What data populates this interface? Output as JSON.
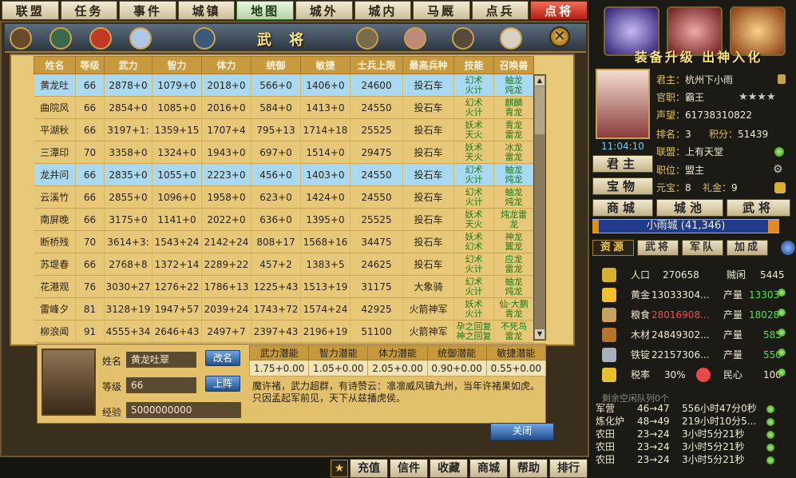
{
  "topnav": [
    "联盟",
    "任务",
    "事件",
    "城镇",
    "地图",
    "城外",
    "城内",
    "马厩",
    "点兵",
    "点将"
  ],
  "panel": {
    "title": "武 将",
    "close_label": "关闭"
  },
  "table": {
    "headers": [
      "姓名",
      "等级",
      "武力",
      "智力",
      "体力",
      "统御",
      "敏捷",
      "士兵上限",
      "最高兵种",
      "技能",
      "召唤兽"
    ],
    "rows": [
      {
        "name": "黄龙吐",
        "lv": "66",
        "wu": "2878+0",
        "zhi": "1079+0",
        "ti": "2018+0",
        "tong": "566+0",
        "min": "1406+0",
        "cap": "24600",
        "troop": "投石车",
        "skill": [
          "幻术",
          "火计"
        ],
        "beast": [
          "蚰龙",
          "炖龙"
        ],
        "selected": true
      },
      {
        "name": "曲院风",
        "lv": "66",
        "wu": "2854+0",
        "zhi": "1085+0",
        "ti": "2016+0",
        "tong": "584+0",
        "min": "1413+0",
        "cap": "24550",
        "troop": "投石车",
        "skill": [
          "幻术",
          "火计"
        ],
        "beast": [
          "麒麟",
          "青龙"
        ],
        "selected": false
      },
      {
        "name": "平湖秋",
        "lv": "66",
        "wu": "3197+1:",
        "zhi": "1359+15",
        "ti": "1707+4",
        "tong": "795+13",
        "min": "1714+18",
        "cap": "25525",
        "troop": "投石车",
        "skill": [
          "妖术",
          "天火"
        ],
        "beast": [
          "青龙",
          "雷龙"
        ],
        "selected": false
      },
      {
        "name": "三潭印",
        "lv": "70",
        "wu": "3358+0",
        "zhi": "1324+0",
        "ti": "1943+0",
        "tong": "697+0",
        "min": "1514+0",
        "cap": "29475",
        "troop": "投石车",
        "skill": [
          "妖术",
          "天火"
        ],
        "beast": [
          "冰龙",
          "雷龙"
        ],
        "selected": false
      },
      {
        "name": "龙井问",
        "lv": "66",
        "wu": "2835+0",
        "zhi": "1055+0",
        "ti": "2223+0",
        "tong": "456+0",
        "min": "1403+0",
        "cap": "24550",
        "troop": "投石车",
        "skill": [
          "幻术",
          "火计"
        ],
        "beast": [
          "蚰龙",
          "炖龙"
        ],
        "selected": true
      },
      {
        "name": "云溪竹",
        "lv": "66",
        "wu": "2855+0",
        "zhi": "1096+0",
        "ti": "1958+0",
        "tong": "623+0",
        "min": "1424+0",
        "cap": "24550",
        "troop": "投石车",
        "skill": [
          "幻术",
          "火计"
        ],
        "beast": [
          "蚰龙",
          "炖龙"
        ],
        "selected": false
      },
      {
        "name": "南屏晚",
        "lv": "66",
        "wu": "3175+0",
        "zhi": "1141+0",
        "ti": "2022+0",
        "tong": "636+0",
        "min": "1395+0",
        "cap": "25525",
        "troop": "投石车",
        "skill": [
          "妖术",
          "天火"
        ],
        "beast": [
          "炖龙雷",
          "龙"
        ],
        "selected": false
      },
      {
        "name": "断桥残",
        "lv": "70",
        "wu": "3614+3:",
        "zhi": "1543+24",
        "ti": "2142+24",
        "tong": "808+17",
        "min": "1568+16",
        "cap": "34475",
        "troop": "投石车",
        "skill": [
          "妖术",
          "幻术"
        ],
        "beast": [
          "神龙",
          "翼龙"
        ],
        "selected": false
      },
      {
        "name": "苏堤春",
        "lv": "66",
        "wu": "2768+8",
        "zhi": "1372+14",
        "ti": "2289+22",
        "tong": "457+2",
        "min": "1383+5",
        "cap": "24625",
        "troop": "投石车",
        "skill": [
          "幻术",
          "火计"
        ],
        "beast": [
          "应龙",
          "雷龙"
        ],
        "selected": false
      },
      {
        "name": "花港观",
        "lv": "76",
        "wu": "3030+27",
        "zhi": "1276+22",
        "ti": "1786+13",
        "tong": "1225+43",
        "min": "1513+19",
        "cap": "31175",
        "troop": "大象骑",
        "skill": [
          "幻术",
          "火计"
        ],
        "beast": [
          "蚰龙",
          "炖龙"
        ],
        "selected": false
      },
      {
        "name": "雷峰夕",
        "lv": "81",
        "wu": "3128+19",
        "zhi": "1947+57",
        "ti": "2039+24",
        "tong": "1743+72",
        "min": "1574+24",
        "cap": "42925",
        "troop": "火箭神军",
        "skill": [
          "妖术",
          "火计"
        ],
        "beast": [
          "仙·大鹏",
          "青龙"
        ],
        "selected": false
      },
      {
        "name": "柳浪闻",
        "lv": "91",
        "wu": "4555+34",
        "zhi": "2646+43",
        "ti": "2497+7",
        "tong": "2397+43",
        "min": "2196+19",
        "cap": "51100",
        "troop": "火箭神军",
        "skill": [
          "孕之回复",
          "神之回复"
        ],
        "beast": [
          "不死鸟",
          "雷龙"
        ],
        "selected": false
      }
    ]
  },
  "detail": {
    "name_label": "姓名",
    "name_value": "黄龙吐翠",
    "level_label": "等级",
    "level_value": "66",
    "exp_label": "经验",
    "exp_value": "5000000000",
    "rename_btn": "改名",
    "deploy_btn": "上阵",
    "potential_headers": [
      "武力潜能",
      "智力潜能",
      "体力潜能",
      "统御潜能",
      "敏捷潜能"
    ],
    "potential_values": [
      "1.75+0.00",
      "1.05+0.00",
      "2.05+0.00",
      "0.90+0.00",
      "0.55+0.00"
    ],
    "description": "魔许褚，武力超群，有诗赞云：凛凛威风镇九州，当年许褚果如虎。只因孟起军前见，天下从兹播虎侯。"
  },
  "bottomnav": [
    "充值",
    "信件",
    "收藏",
    "商城",
    "帮助",
    "排行"
  ],
  "right": {
    "equip_banner": "装备升级 出神入化",
    "clock": "11:04:10",
    "info": [
      {
        "label": "君主：",
        "value": "杭州下小雨"
      },
      {
        "label": "官职：",
        "value": "霸王"
      },
      {
        "label": "声望：",
        "value": "61738310822"
      },
      {
        "label": "排名：",
        "value": "3"
      },
      {
        "label": "积分：",
        "value": "51439"
      },
      {
        "label": "联盟：",
        "value": "上有天堂"
      },
      {
        "label": "职位：",
        "value": "盟主"
      },
      {
        "label": "元宝：",
        "value": "8"
      },
      {
        "label": "礼金：",
        "value": "9"
      }
    ],
    "buttons": [
      "君主",
      "宝物",
      "商城",
      "城池",
      "武将"
    ],
    "city": "小雨城 (41,346)",
    "tabs": [
      "资源",
      "武将",
      "军队",
      "加成"
    ],
    "resources": {
      "population_label": "人口",
      "population": "270658",
      "idle_label": "贼闲",
      "idle": "5445",
      "gold_label": "黄金",
      "gold": "13033304...",
      "gold_prod_label": "产量",
      "gold_prod": "13303",
      "food_label": "粮食",
      "food": "28016908...",
      "food_prod_label": "产量",
      "food_prod": "18028",
      "wood_label": "木材",
      "wood": "24849302...",
      "wood_prod_label": "产量",
      "wood_prod": "585",
      "iron_label": "铁锭",
      "iron": "22157306...",
      "iron_prod_label": "产量",
      "iron_prod": "550",
      "tax_label": "税率",
      "tax": "30%",
      "morale_label": "民心",
      "morale": "100"
    },
    "queue_label": "剩余空闲队列0个",
    "queue": [
      {
        "name": "军营",
        "lv": "46→47",
        "time": "556小时47分0秒"
      },
      {
        "name": "炼化炉",
        "lv": "48→49",
        "time": "219小时10分5..."
      },
      {
        "name": "农田",
        "lv": "23→24",
        "time": "3小时5分21秒"
      },
      {
        "name": "农田",
        "lv": "23→24",
        "time": "3小时5分21秒"
      },
      {
        "name": "农田",
        "lv": "23→24",
        "time": "3小时5分21秒"
      }
    ]
  }
}
